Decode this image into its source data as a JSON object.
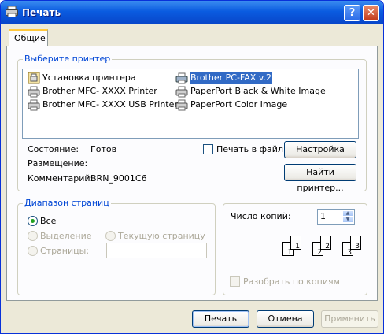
{
  "window": {
    "title": "Печать",
    "help_label": "?",
    "close_label": "✕"
  },
  "tabs": [
    {
      "label": "Общие"
    }
  ],
  "printer_group": {
    "title": "Выберите принтер",
    "printers": [
      {
        "name": "Установка принтера",
        "icon": "add-printer-icon"
      },
      {
        "name": "Brother MFC-  XXXX  Printer",
        "icon": "printer-icon"
      },
      {
        "name": "Brother MFC-  XXXX  USB Printer",
        "icon": "printer-icon"
      },
      {
        "name": "Brother PC-FAX v.2",
        "icon": "fax-printer-icon",
        "selected": true
      },
      {
        "name": "PaperPort Black & White Image",
        "icon": "printer-icon"
      },
      {
        "name": "PaperPort Color Image",
        "icon": "printer-icon"
      }
    ],
    "status_label": "Состояние:",
    "status_value": "Готов",
    "location_label": "Размещение:",
    "location_value": "",
    "comment_label": "Комментарий:",
    "comment_value": "BRN_9001C6",
    "print_to_file_label": "Печать в файл",
    "settings_button": "Настройка",
    "find_printer_button": "Найти принтер..."
  },
  "page_range": {
    "title": "Диапазон страниц",
    "all_label": "Все",
    "selection_label": "Выделение",
    "current_page_label": "Текущую страницу",
    "pages_label": "Страницы:",
    "pages_value": ""
  },
  "copies": {
    "count_label": "Число копий:",
    "count_value": "1",
    "collate_label": "Разобрать по копиям",
    "collate_pages": [
      "1",
      "1",
      "2",
      "2",
      "3",
      "3"
    ]
  },
  "buttons": {
    "print": "Печать",
    "cancel": "Отмена",
    "apply": "Применить"
  },
  "colors": {
    "accent": "#0046d5",
    "selection": "#316ac5",
    "titlebar": "#0a5be0"
  }
}
